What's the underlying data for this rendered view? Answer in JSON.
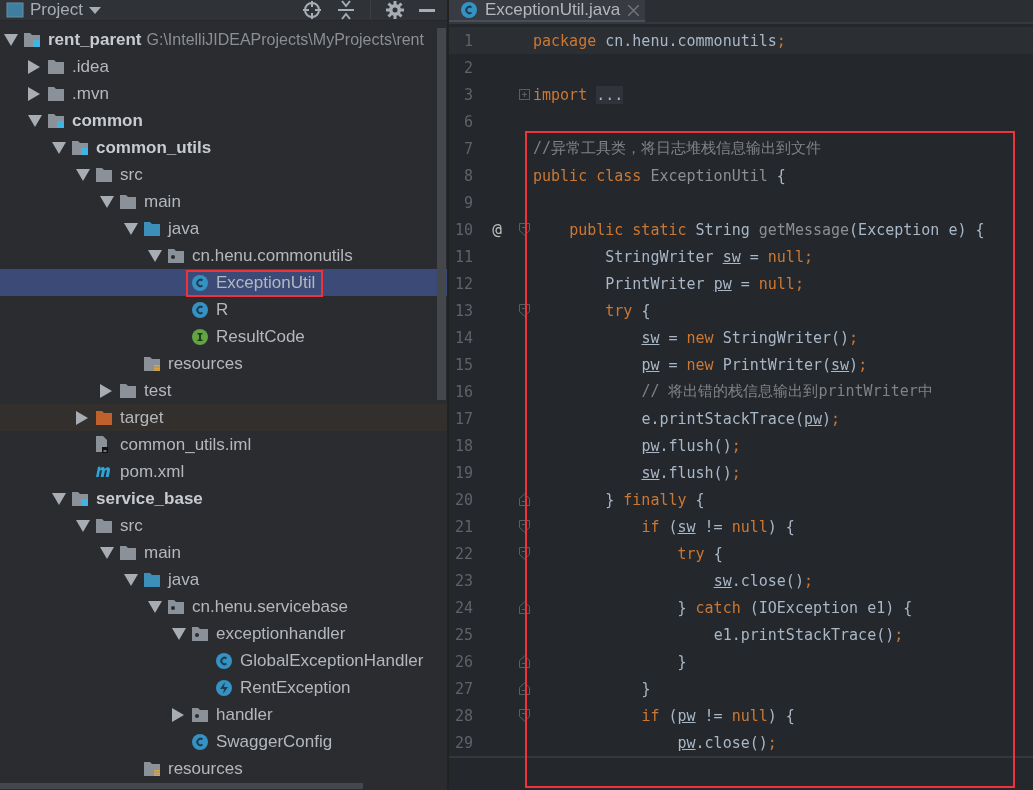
{
  "project_panel": {
    "title": "Project",
    "tree": [
      {
        "label": "rent_parent",
        "path": "G:\\IntelliJIDEAProjects\\MyProjects\\rent",
        "kind": "module",
        "expanded": true,
        "selected": false,
        "children": [
          {
            "label": ".idea",
            "kind": "folder",
            "expanded": false,
            "selected": false
          },
          {
            "label": ".mvn",
            "kind": "folder",
            "expanded": false,
            "selected": false
          },
          {
            "label": "common",
            "kind": "module",
            "expanded": true,
            "selected": false,
            "children": [
              {
                "label": "common_utils",
                "kind": "module",
                "expanded": true,
                "selected": false,
                "children": [
                  {
                    "label": "src",
                    "kind": "folder",
                    "expanded": true,
                    "selected": false,
                    "children": [
                      {
                        "label": "main",
                        "kind": "folder",
                        "expanded": true,
                        "selected": false,
                        "children": [
                          {
                            "label": "java",
                            "kind": "source",
                            "expanded": true,
                            "selected": false,
                            "children": [
                              {
                                "label": "cn.henu.commonutils",
                                "kind": "package",
                                "expanded": true,
                                "selected": false,
                                "children": [
                                  {
                                    "label": "ExceptionUtil",
                                    "kind": "class",
                                    "selected": true,
                                    "annotated": true
                                  },
                                  {
                                    "label": "R",
                                    "kind": "class",
                                    "selected": false
                                  },
                                  {
                                    "label": "ResultCode",
                                    "kind": "interface",
                                    "selected": false
                                  }
                                ]
                              }
                            ]
                          },
                          {
                            "label": "resources",
                            "kind": "resources",
                            "selected": false
                          }
                        ]
                      },
                      {
                        "label": "test",
                        "kind": "folder",
                        "expanded": false,
                        "selected": false
                      }
                    ]
                  },
                  {
                    "label": "target",
                    "kind": "excluded",
                    "expanded": false,
                    "selected": false
                  },
                  {
                    "label": "common_utils.iml",
                    "kind": "iml",
                    "selected": false
                  },
                  {
                    "label": "pom.xml",
                    "kind": "maven",
                    "selected": false
                  }
                ]
              },
              {
                "label": "service_base",
                "kind": "module",
                "expanded": true,
                "selected": false,
                "children": [
                  {
                    "label": "src",
                    "kind": "folder",
                    "expanded": true,
                    "selected": false,
                    "children": [
                      {
                        "label": "main",
                        "kind": "folder",
                        "expanded": true,
                        "selected": false,
                        "children": [
                          {
                            "label": "java",
                            "kind": "source",
                            "expanded": true,
                            "selected": false,
                            "children": [
                              {
                                "label": "cn.henu.servicebase",
                                "kind": "package",
                                "expanded": true,
                                "selected": false,
                                "children": [
                                  {
                                    "label": "exceptionhandler",
                                    "kind": "package",
                                    "expanded": true,
                                    "selected": false,
                                    "children": [
                                      {
                                        "label": "GlobalExceptionHandler",
                                        "kind": "class",
                                        "selected": false
                                      },
                                      {
                                        "label": "RentException",
                                        "kind": "exception",
                                        "selected": false
                                      }
                                    ]
                                  },
                                  {
                                    "label": "handler",
                                    "kind": "package",
                                    "expanded": false,
                                    "selected": false
                                  },
                                  {
                                    "label": "SwaggerConfig",
                                    "kind": "class",
                                    "selected": false
                                  }
                                ]
                              }
                            ]
                          },
                          {
                            "label": "resources",
                            "kind": "resources",
                            "selected": false
                          }
                        ]
                      }
                    ]
                  }
                ]
              }
            ]
          }
        ]
      }
    ]
  },
  "editor": {
    "tabs": [
      {
        "label": "ExceptionUtil.java",
        "kind": "class",
        "selected": true
      }
    ],
    "lines": [
      {
        "number": "1",
        "current": true,
        "tokens": [
          {
            "text": "package",
            "kind": "keyword"
          },
          {
            "text": " cn.henu.commonutils",
            "kind": "plain"
          },
          {
            "text": ";",
            "kind": "keyword"
          }
        ]
      },
      {
        "number": "2"
      },
      {
        "number": "3",
        "folded": true,
        "tokens": [
          {
            "text": "import ",
            "kind": "keyword"
          },
          {
            "text": "...",
            "kind": "folded"
          }
        ]
      },
      {
        "number": "6"
      }
    ],
    "annotation": {
      "lines": [
        {
          "number": "7",
          "tokens": [
            {
              "text": "//异常工具类，将日志堆栈信息输出到文件",
              "kind": "comment"
            }
          ]
        },
        {
          "number": "8",
          "tokens": [
            {
              "text": "public class ",
              "kind": "keyword"
            },
            {
              "text": "ExceptionUtil",
              "kind": "declaration"
            },
            {
              "text": " {",
              "kind": "plain"
            }
          ]
        },
        {
          "number": "9"
        },
        {
          "number": "10",
          "gutter_mark": "@",
          "fold_start": true,
          "tokens": [
            {
              "text": "    public static",
              "kind": "keyword"
            },
            {
              "text": " String ",
              "kind": "plain"
            },
            {
              "text": "getMessage",
              "kind": "declaration"
            },
            {
              "text": "(Exception e) {",
              "kind": "plain"
            }
          ]
        },
        {
          "number": "11",
          "tokens": [
            {
              "text": "        StringWriter ",
              "kind": "plain"
            },
            {
              "text": "sw",
              "kind": "local"
            },
            {
              "text": " = ",
              "kind": "plain"
            },
            {
              "text": "null;",
              "kind": "keyword"
            }
          ]
        },
        {
          "number": "12",
          "tokens": [
            {
              "text": "        PrintWriter ",
              "kind": "plain"
            },
            {
              "text": "pw",
              "kind": "local"
            },
            {
              "text": " = ",
              "kind": "plain"
            },
            {
              "text": "null;",
              "kind": "keyword"
            }
          ]
        },
        {
          "number": "13",
          "fold_start": true,
          "tokens": [
            {
              "text": "        try",
              "kind": "keyword"
            },
            {
              "text": " {",
              "kind": "plain"
            }
          ]
        },
        {
          "number": "14",
          "tokens": [
            {
              "text": "            sw",
              "kind": "local"
            },
            {
              "text": " = ",
              "kind": "plain"
            },
            {
              "text": "new",
              "kind": "keyword"
            },
            {
              "text": " StringWriter()",
              "kind": "plain"
            },
            {
              "text": ";",
              "kind": "keyword"
            }
          ]
        },
        {
          "number": "15",
          "tokens": [
            {
              "text": "            pw",
              "kind": "local"
            },
            {
              "text": " = ",
              "kind": "plain"
            },
            {
              "text": "new",
              "kind": "keyword"
            },
            {
              "text": " PrintWriter(",
              "kind": "plain"
            },
            {
              "text": "sw",
              "kind": "local"
            },
            {
              "text": ")",
              "kind": "plain"
            },
            {
              "text": ";",
              "kind": "keyword"
            }
          ]
        },
        {
          "number": "16",
          "tokens": [
            {
              "text": "            // 将出错的栈信息输出到printWriter中",
              "kind": "comment"
            }
          ]
        },
        {
          "number": "17",
          "tokens": [
            {
              "text": "            e.printStackTrace(",
              "kind": "plain"
            },
            {
              "text": "pw",
              "kind": "local"
            },
            {
              "text": ")",
              "kind": "plain"
            },
            {
              "text": ";",
              "kind": "keyword"
            }
          ]
        },
        {
          "number": "18",
          "tokens": [
            {
              "text": "            pw",
              "kind": "local"
            },
            {
              "text": ".flush()",
              "kind": "plain"
            },
            {
              "text": ";",
              "kind": "keyword"
            }
          ]
        },
        {
          "number": "19",
          "tokens": [
            {
              "text": "            sw",
              "kind": "local"
            },
            {
              "text": ".flush()",
              "kind": "plain"
            },
            {
              "text": ";",
              "kind": "keyword"
            }
          ]
        },
        {
          "number": "20",
          "fold_end": true,
          "tokens": [
            {
              "text": "        } ",
              "kind": "plain"
            },
            {
              "text": "finally",
              "kind": "keyword"
            },
            {
              "text": " {",
              "kind": "plain"
            }
          ]
        },
        {
          "number": "21",
          "fold_start": true,
          "tokens": [
            {
              "text": "            if",
              "kind": "keyword"
            },
            {
              "text": " (",
              "kind": "plain"
            },
            {
              "text": "sw",
              "kind": "local"
            },
            {
              "text": " != ",
              "kind": "plain"
            },
            {
              "text": "null",
              "kind": "keyword"
            },
            {
              "text": ") {",
              "kind": "plain"
            }
          ]
        },
        {
          "number": "22",
          "fold_start": true,
          "tokens": [
            {
              "text": "                try",
              "kind": "keyword"
            },
            {
              "text": " {",
              "kind": "plain"
            }
          ]
        },
        {
          "number": "23",
          "tokens": [
            {
              "text": "                    sw",
              "kind": "local"
            },
            {
              "text": ".close()",
              "kind": "plain"
            },
            {
              "text": ";",
              "kind": "keyword"
            }
          ]
        },
        {
          "number": "24",
          "fold_end": true,
          "tokens": [
            {
              "text": "                } ",
              "kind": "plain"
            },
            {
              "text": "catch",
              "kind": "keyword"
            },
            {
              "text": " (IOException e1) {",
              "kind": "plain"
            }
          ]
        },
        {
          "number": "25",
          "tokens": [
            {
              "text": "                    e1.printStackTrace()",
              "kind": "plain"
            },
            {
              "text": ";",
              "kind": "keyword"
            }
          ]
        },
        {
          "number": "26",
          "fold_end": true,
          "tokens": [
            {
              "text": "                }",
              "kind": "plain"
            }
          ]
        },
        {
          "number": "27",
          "fold_end": true,
          "tokens": [
            {
              "text": "            }",
              "kind": "plain"
            }
          ]
        },
        {
          "number": "28",
          "fold_start": true,
          "tokens": [
            {
              "text": "            if",
              "kind": "keyword"
            },
            {
              "text": " (",
              "kind": "plain"
            },
            {
              "text": "pw",
              "kind": "local"
            },
            {
              "text": " != ",
              "kind": "plain"
            },
            {
              "text": "null",
              "kind": "keyword"
            },
            {
              "text": ") {",
              "kind": "plain"
            }
          ]
        },
        {
          "number": "29",
          "tokens": [
            {
              "text": "                pw",
              "kind": "local"
            },
            {
              "text": ".close()",
              "kind": "plain"
            },
            {
              "text": ";",
              "kind": "keyword"
            }
          ]
        }
      ]
    }
  }
}
